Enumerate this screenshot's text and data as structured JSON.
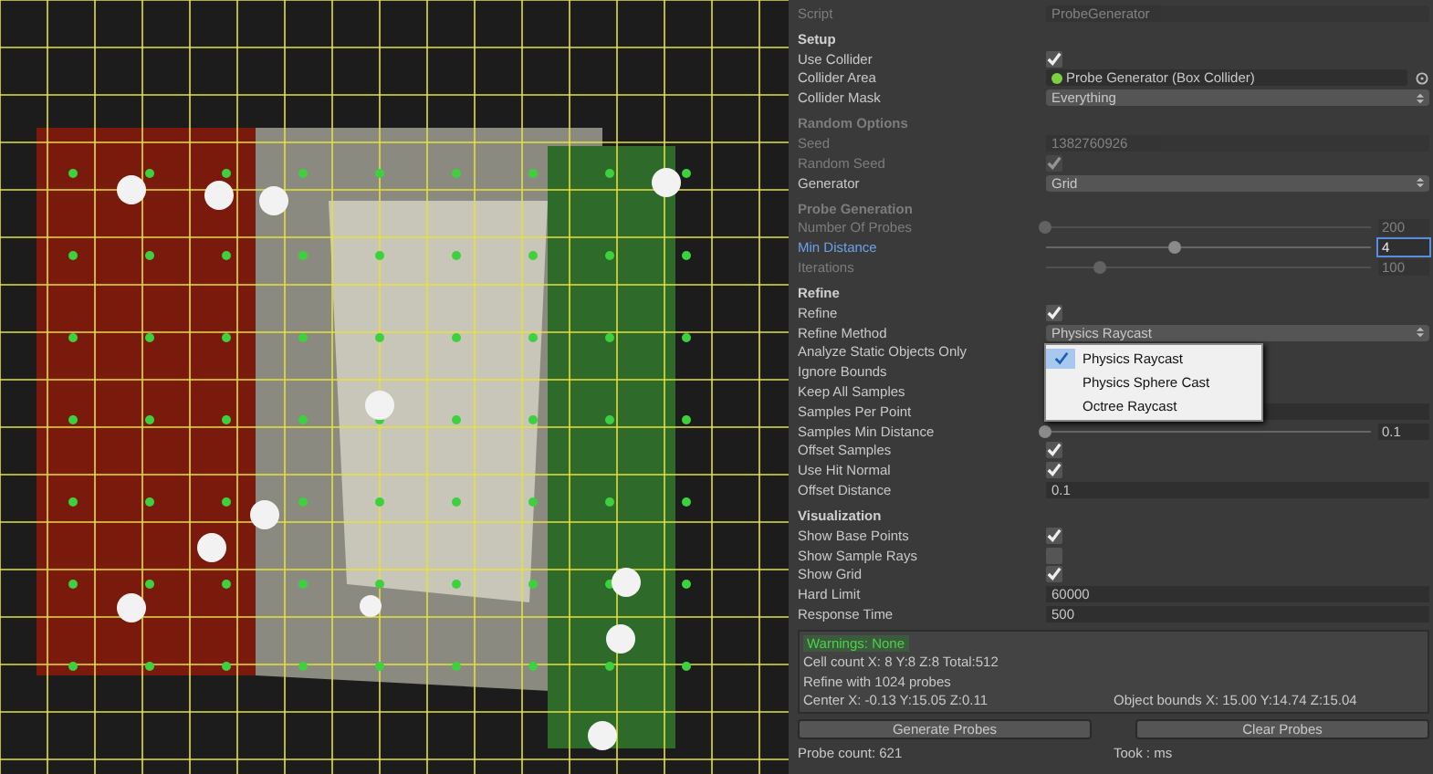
{
  "inspector": {
    "sections": [
      {
        "rows": [
          {
            "kind": "object",
            "label": "Script",
            "value": "ProbeGenerator",
            "disabled": true,
            "focused": false
          }
        ]
      },
      {
        "title": "Setup",
        "disabled": false,
        "rows": [
          {
            "kind": "checkbox",
            "label": "Use Collider",
            "checked": true,
            "disabled": false,
            "focused": false
          },
          {
            "kind": "object",
            "label": "Collider Area",
            "value": "Probe Generator (Box Collider)",
            "disabled": false,
            "focused": false,
            "dot": true
          },
          {
            "kind": "dropdown",
            "label": "Collider Mask",
            "value": "Everything",
            "disabled": false,
            "focused": false
          }
        ]
      },
      {
        "title": "Random Options",
        "disabled": true,
        "rows": [
          {
            "kind": "field",
            "label": "Seed",
            "value": "1382760926",
            "disabled": true,
            "focused": false
          },
          {
            "kind": "checkbox",
            "label": "Random Seed",
            "checked": true,
            "disabled": true,
            "focused": false
          },
          {
            "kind": "dropdown",
            "label": "Generator",
            "value": "Grid",
            "disabled": false,
            "focused": false
          }
        ]
      },
      {
        "title": "Probe Generation",
        "disabled": true,
        "rows": [
          {
            "kind": "slider",
            "label": "Number Of Probes",
            "level": 0.0,
            "value": "200",
            "disabled": true,
            "focused": false
          },
          {
            "kind": "slider",
            "label": "Min Distance",
            "level": 0.4,
            "value": "4",
            "disabled": false,
            "focused": true
          },
          {
            "kind": "slider",
            "label": "Iterations",
            "level": 0.17,
            "value": "100",
            "disabled": true,
            "focused": false
          }
        ]
      },
      {
        "title": "Refine",
        "disabled": false,
        "rows": [
          {
            "kind": "checkbox",
            "label": "Refine",
            "checked": true,
            "disabled": false,
            "focused": false
          },
          {
            "kind": "dropdown",
            "label": "Refine Method",
            "value": "Physics Raycast",
            "disabled": false,
            "focused": false
          },
          {
            "kind": "label",
            "label": "Analyze Static Objects Only",
            "disabled": false,
            "focused": false
          },
          {
            "kind": "label",
            "label": "Ignore Bounds",
            "disabled": false,
            "focused": false
          },
          {
            "kind": "label",
            "label": "Keep All Samples",
            "disabled": false,
            "focused": false
          },
          {
            "kind": "field",
            "label": "Samples Per Point",
            "disabled": false,
            "focused": false
          },
          {
            "kind": "slider",
            "label": "Samples Min Distance",
            "level": 0.0,
            "value": "0.1",
            "disabled": false,
            "focused": false
          }
        ]
      },
      {
        "rows": [
          {
            "kind": "checkbox",
            "label": "Offset Samples",
            "checked": true,
            "disabled": false,
            "focused": false
          },
          {
            "kind": "checkbox",
            "label": "Use Hit Normal",
            "checked": true,
            "disabled": false,
            "focused": false
          },
          {
            "kind": "field",
            "label": "Offset Distance",
            "value": "0.1",
            "disabled": false,
            "focused": false
          }
        ]
      },
      {
        "title": "Visualization",
        "disabled": false,
        "rows": [
          {
            "kind": "checkbox",
            "label": "Show Base Points",
            "checked": true,
            "disabled": false,
            "focused": false
          },
          {
            "kind": "checkbox",
            "label": "Show Sample Rays",
            "checked": false,
            "disabled": false,
            "focused": false
          },
          {
            "kind": "checkbox",
            "label": "Show Grid",
            "checked": true,
            "disabled": false,
            "focused": false
          },
          {
            "kind": "field",
            "label": "Hard Limit",
            "value": "60000",
            "disabled": false,
            "focused": false
          },
          {
            "kind": "field",
            "label": "Response Time",
            "value": "500",
            "disabled": false,
            "focused": false
          }
        ]
      }
    ],
    "popup": {
      "items": [
        {
          "label": "Physics Raycast",
          "selected": true
        },
        {
          "label": "Physics Sphere Cast",
          "selected": false
        },
        {
          "label": "Octree Raycast",
          "selected": false
        }
      ]
    },
    "info": [
      {
        "kind": "warning",
        "texts": [
          "Warnings: None"
        ]
      },
      {
        "kind": "text",
        "texts": [
          "Cell count X: 8 Y:8 Z:8 Total:512"
        ]
      },
      {
        "kind": "text",
        "texts": [
          "Refine with 1024 probes"
        ]
      },
      {
        "kind": "text",
        "texts": [
          "Center X: -0.13 Y:15.05 Z:0.11",
          "Object bounds X: 15.00 Y:14.74 Z:15.04"
        ]
      }
    ],
    "buttons": [
      "Generate Probes",
      "Clear Probes"
    ],
    "footer": [
      "Probe count: 621",
      "Took : ms"
    ]
  }
}
